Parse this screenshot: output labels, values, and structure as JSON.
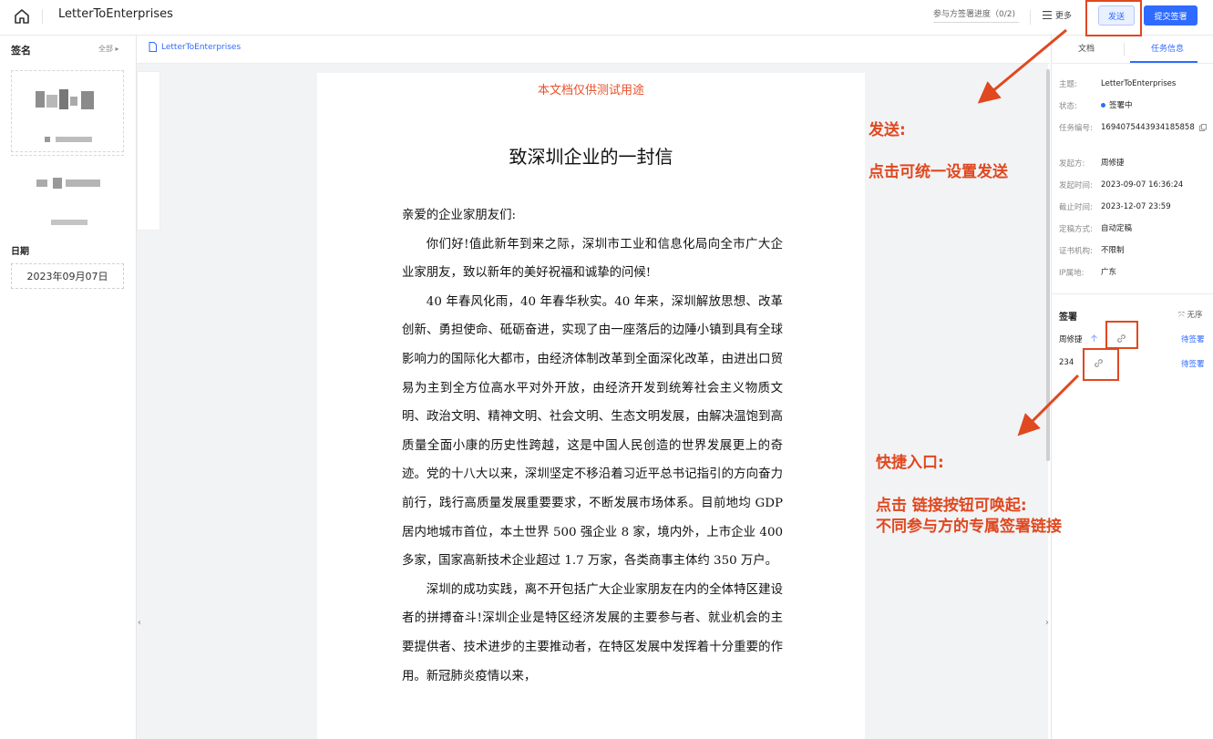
{
  "header": {
    "doc_title": "LetterToEnterprises",
    "progress": "参与方签署进度（0/2)",
    "more_label": "更多",
    "send_label": "发送",
    "submit_label": "提交签署"
  },
  "left_sidebar": {
    "signature_title": "签名",
    "all_label": "全部",
    "date_title": "日期",
    "date_value": "2023年09月07日"
  },
  "breadcrumb": {
    "file_name": "LetterToEnterprises"
  },
  "document": {
    "watermark": "本文档仅供测试用途",
    "heading": "致深圳企业的一封信",
    "salutation": "亲爱的企业家朋友们:",
    "paragraphs": [
      "你们好!值此新年到来之际，深圳市工业和信息化局向全市广大企业家朋友，致以新年的美好祝福和诚挚的问候!",
      "40 年春风化雨，40 年春华秋实。40 年来，深圳解放思想、改革创新、勇担使命、砥砺奋进，实现了由一座落后的边陲小镇到具有全球影响力的国际化大都市，由经济体制改革到全面深化改革，由进出口贸易为主到全方位高水平对外开放，由经济开发到统筹社会主义物质文明、政治文明、精神文明、社会文明、生态文明发展，由解决温饱到高质量全面小康的历史性跨越，这是中国人民创造的世界发展更上的奇迹。党的十八大以来，深圳坚定不移沿着习近平总书记指引的方向奋力前行，践行高质量发展重要要求，不断发展市场体系。目前地均 GDP 居内地城市首位，本土世界 500 强企业 8 家，境内外，上市企业 400 多家，国家高新技术企业超过 1.7 万家，各类商事主体约 350 万户。",
      "深圳的成功实践，离不开包括广大企业家朋友在内的全体特区建设者的拼搏奋斗!深圳企业是特区经济发展的主要参与者、就业机会的主要提供者、技术进步的主要推动者，在特区发展中发挥着十分重要的作用。新冠肺炎疫情以来，"
    ]
  },
  "right_panel": {
    "tab_doc": "文档",
    "tab_task": "任务信息",
    "info": [
      {
        "k": "主题:",
        "v": "LetterToEnterprises"
      },
      {
        "k": "状态:",
        "v": "签署中"
      },
      {
        "k": "任务编号:",
        "v": "1694075443934185858"
      },
      {
        "k": "发起方:",
        "v": "周修捷"
      },
      {
        "k": "发起时间:",
        "v": "2023-09-07 16:36:24"
      },
      {
        "k": "截止时间:",
        "v": "2023-12-07 23:59"
      },
      {
        "k": "定稿方式:",
        "v": "自动定稿"
      },
      {
        "k": "证书机构:",
        "v": "不限制"
      },
      {
        "k": "IP属地:",
        "v": "广东"
      }
    ],
    "sign_title": "签署",
    "order_label": "无序",
    "signers": [
      {
        "name": "周修捷",
        "status": "待签署"
      },
      {
        "name": "234",
        "status": "待签署"
      }
    ]
  },
  "annotations": {
    "send_title": "发送:",
    "send_desc": "点击可统一设置发送",
    "shortcut_title": "快捷入口:",
    "shortcut_desc1": "点击 链接按钮可唤起:",
    "shortcut_desc2": "不同参与方的专属签署链接"
  },
  "colors": {
    "accent": "#2f6bff",
    "annotation": "#e0481f",
    "watermark": "#e8502a"
  }
}
